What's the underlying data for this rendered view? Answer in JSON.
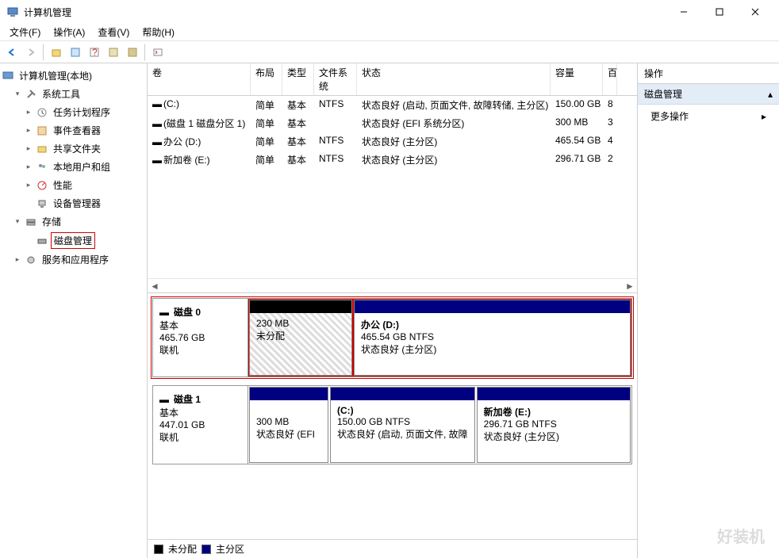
{
  "window": {
    "title": "计算机管理"
  },
  "menu": {
    "file": "文件(F)",
    "action": "操作(A)",
    "view": "查看(V)",
    "help": "帮助(H)"
  },
  "tree": {
    "root": "计算机管理(本地)",
    "sys_tools": "系统工具",
    "task_sched": "任务计划程序",
    "event_viewer": "事件查看器",
    "shared": "共享文件夹",
    "users": "本地用户和组",
    "perf": "性能",
    "devmgr": "设备管理器",
    "storage": "存储",
    "diskmgmt": "磁盘管理",
    "services": "服务和应用程序"
  },
  "list": {
    "headers": {
      "vol": "卷",
      "layout": "布局",
      "type": "类型",
      "fs": "文件系统",
      "status": "状态",
      "capacity": "容量",
      "last": "百"
    },
    "rows": [
      {
        "vol": "(C:)",
        "layout": "简单",
        "type": "基本",
        "fs": "NTFS",
        "status": "状态良好 (启动, 页面文件, 故障转储, 主分区)",
        "capacity": "150.00 GB",
        "last": "8"
      },
      {
        "vol": "(磁盘 1 磁盘分区 1)",
        "layout": "简单",
        "type": "基本",
        "fs": "",
        "status": "状态良好 (EFI 系统分区)",
        "capacity": "300 MB",
        "last": "3"
      },
      {
        "vol": "办公 (D:)",
        "layout": "简单",
        "type": "基本",
        "fs": "NTFS",
        "status": "状态良好 (主分区)",
        "capacity": "465.54 GB",
        "last": "4"
      },
      {
        "vol": "新加卷 (E:)",
        "layout": "简单",
        "type": "基本",
        "fs": "NTFS",
        "status": "状态良好 (主分区)",
        "capacity": "296.71 GB",
        "last": "2"
      }
    ]
  },
  "disks": {
    "disk0": {
      "name": "磁盘 0",
      "type": "基本",
      "size": "465.76 GB",
      "state": "联机",
      "p1": {
        "size": "230 MB",
        "status": "未分配"
      },
      "p2": {
        "name": "办公  (D:)",
        "size": "465.54 GB NTFS",
        "status": "状态良好 (主分区)"
      }
    },
    "disk1": {
      "name": "磁盘 1",
      "type": "基本",
      "size": "447.01 GB",
      "state": "联机",
      "p1": {
        "size": "300 MB",
        "status": "状态良好 (EFI"
      },
      "p2": {
        "name": "(C:)",
        "size": "150.00 GB NTFS",
        "status": "状态良好 (启动, 页面文件, 故障"
      },
      "p3": {
        "name": "新加卷  (E:)",
        "size": "296.71 GB NTFS",
        "status": "状态良好 (主分区)"
      }
    }
  },
  "legend": {
    "unalloc": "未分配",
    "primary": "主分区"
  },
  "actions": {
    "header": "操作",
    "section": "磁盘管理",
    "more": "更多操作"
  },
  "watermark": "好装机"
}
